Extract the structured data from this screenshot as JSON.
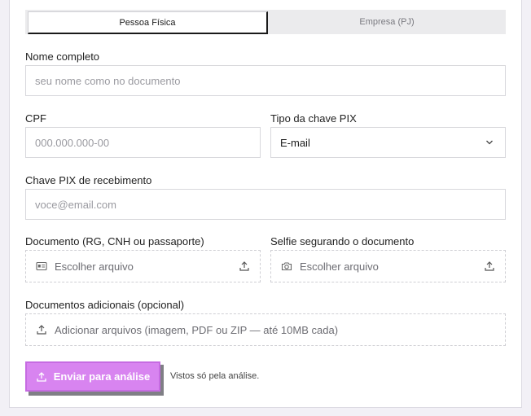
{
  "tabs": [
    {
      "label": "Pessoa Física",
      "active": true
    },
    {
      "label": "Empresa (PJ)",
      "active": false
    }
  ],
  "form": {
    "full_name": {
      "label": "Nome completo",
      "placeholder": "seu nome como no documento"
    },
    "cpf": {
      "label": "CPF",
      "placeholder": "000.000.000-00"
    },
    "pix_type": {
      "label": "Tipo da chave PIX",
      "value": "E-mail"
    },
    "pix_key": {
      "label": "Chave PIX de recebimento",
      "placeholder": "voce@email.com"
    },
    "document": {
      "label": "Documento (RG, CNH ou passaporte)",
      "button": "Escolher arquivo"
    },
    "selfie": {
      "label": "Selfie segurando o documento",
      "button": "Escolher arquivo"
    },
    "extra_docs": {
      "label": "Documentos adicionais (opcional)",
      "button": "Adicionar arquivos (imagem, PDF ou ZIP — até 10MB cada)"
    }
  },
  "submit": {
    "label": "Enviar para análise",
    "note": "Vistos só pela análise."
  },
  "colors": {
    "accent": "#d884f0",
    "accent_border": "#c66be2",
    "tab_bg": "#ebebed"
  },
  "icons": [
    "id-card-icon",
    "upload-icon",
    "camera-icon",
    "chevron-down-icon"
  ]
}
